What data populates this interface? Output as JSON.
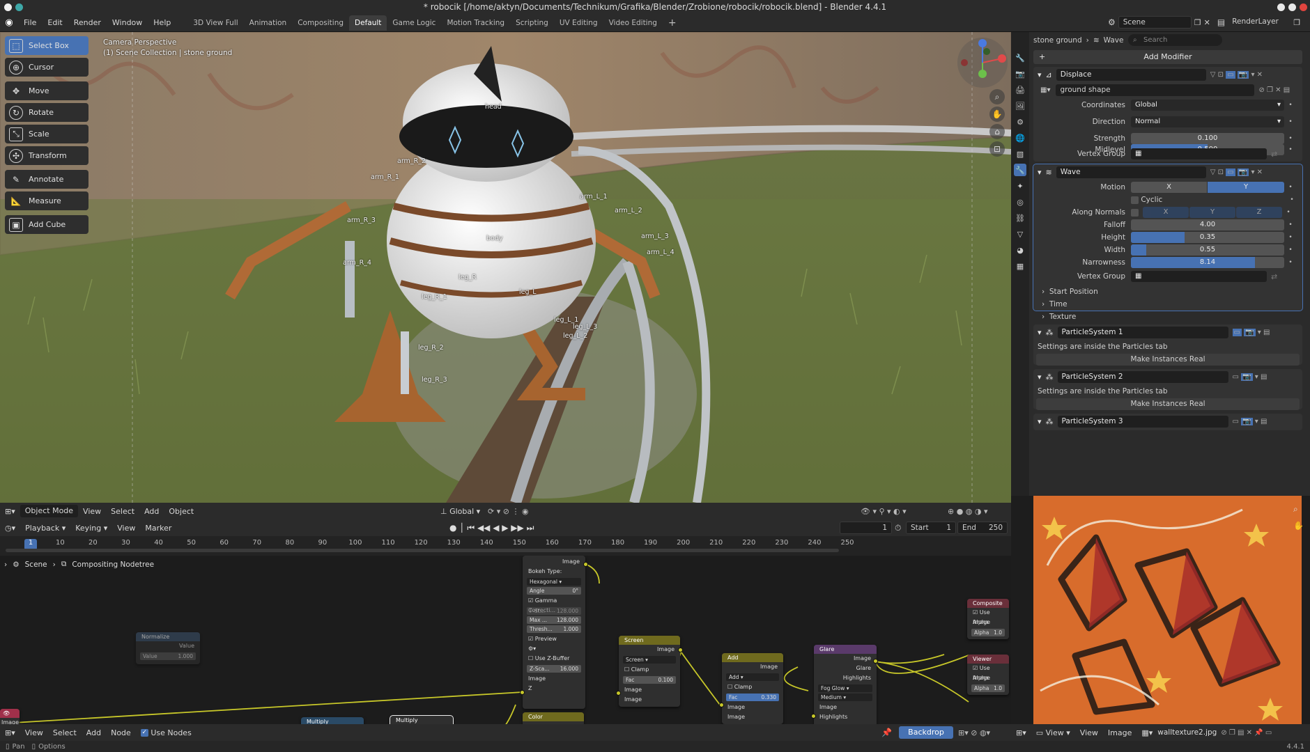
{
  "window": {
    "title": "* robocik [/home/aktyn/Documents/Technikum/Grafika/Blender/Zrobione/robocik/robocik.blend] - Blender 4.4.1"
  },
  "menu": [
    "File",
    "Edit",
    "Render",
    "Window",
    "Help"
  ],
  "workspaces": [
    "3D View Full",
    "Animation",
    "Compositing",
    "Default",
    "Game Logic",
    "Motion Tracking",
    "Scripting",
    "UV Editing",
    "Video Editing"
  ],
  "active_workspace": "Default",
  "scene": {
    "name": "Scene",
    "layer": "RenderLayer"
  },
  "viewport": {
    "perspective": "Camera Perspective",
    "collection": "(1) Scene Collection | stone ground",
    "tools": [
      "Select Box",
      "Cursor",
      "Move",
      "Rotate",
      "Scale",
      "Transform",
      "Annotate",
      "Measure",
      "Add Cube"
    ],
    "bones": [
      "head",
      "arm_R_2",
      "arm_R_1",
      "arm_R_3",
      "arm_R_4",
      "arm_L_1",
      "arm_L_2",
      "arm_L_3",
      "arm_L_4",
      "body",
      "leg_R",
      "leg_R_1",
      "leg_L",
      "leg_L_1",
      "leg_L_3",
      "leg_L_2",
      "leg_R_2",
      "leg_R_3"
    ],
    "header": {
      "mode": "Object Mode",
      "menus": [
        "View",
        "Select",
        "Add",
        "Object"
      ],
      "orientation": "Global"
    }
  },
  "timeline": {
    "menus": [
      "Playback",
      "Keying",
      "View",
      "Marker"
    ],
    "current_frame": "1",
    "start_label": "Start",
    "start": "1",
    "end_label": "End",
    "end": "250",
    "ticks": [
      "1",
      "10",
      "20",
      "30",
      "40",
      "50",
      "60",
      "70",
      "80",
      "90",
      "100",
      "110",
      "120",
      "130",
      "140",
      "150",
      "160",
      "170",
      "180",
      "190",
      "200",
      "210",
      "220",
      "230",
      "240",
      "250"
    ]
  },
  "node_editor": {
    "breadcrumb": [
      "Scene",
      "Compositing Nodetree"
    ],
    "menus": [
      "View",
      "Select",
      "Add",
      "Node"
    ],
    "use_nodes": "Use Nodes",
    "backdrop": "Backdrop",
    "nodes": {
      "normalize": {
        "title": "Normalize",
        "out": "Value",
        "in": "Value",
        "in_val": "1.000"
      },
      "bokeh": {
        "out": "Image",
        "type_label": "Bokeh Type:",
        "type": "Hexagonal",
        "angle_l": "Angle",
        "angle": "0°",
        "gamma": "Gamma Correcti...",
        "fstop_l": "F-St...",
        "fstop": "128.000",
        "max_l": "Max ...",
        "max": "128.000",
        "thresh_l": "Thresh...",
        "thresh": "1.000",
        "preview": "Preview",
        "zbuf": "Use Z-Buffer",
        "zscale_l": "Z-Sca...",
        "zscale": "16.000",
        "in_image": "Image",
        "in_z": "Z"
      },
      "screen": {
        "title": "Screen",
        "out": "Image",
        "mode": "Screen",
        "clamp": "Clamp",
        "fac_l": "Fac",
        "fac": "0.100",
        "in1": "Image",
        "in2": "Image"
      },
      "add": {
        "title": "Add",
        "out": "Image",
        "mode": "Add",
        "clamp": "Clamp",
        "fac_l": "Fac",
        "fac": "0.330",
        "in1": "Image",
        "in2": "Image"
      },
      "glare": {
        "title": "Glare",
        "out1": "Image",
        "out2": "Glare",
        "out3": "Highlights",
        "type": "Fog Glow",
        "quality": "Medium",
        "in": "Image",
        "hl": "Highlights"
      },
      "composite": {
        "title": "Composite",
        "alpha": "Use Alpha",
        "in1": "Image",
        "in2_l": "Alpha",
        "in2": "1.0"
      },
      "viewer": {
        "title": "Viewer",
        "alpha": "Use Alpha",
        "in1": "Image",
        "in2_l": "Alpha",
        "in2": "1.0"
      },
      "multiply1": "Multiply",
      "multiply2": "Multiply",
      "color": "Color",
      "img_in": "Image"
    }
  },
  "properties": {
    "breadcrumb": [
      "stone ground",
      "Wave"
    ],
    "search_placeholder": "Search",
    "add_modifier": "Add Modifier",
    "displace": {
      "name": "Displace",
      "texture": "ground shape",
      "coordinates_l": "Coordinates",
      "coordinates": "Global",
      "direction_l": "Direction",
      "direction": "Normal",
      "strength_l": "Strength",
      "strength": "0.100",
      "midlevel_l": "Midlevel",
      "midlevel": "0.500",
      "midlevel_frac": 0.5,
      "vgroup_l": "Vertex Group"
    },
    "wave": {
      "name": "Wave",
      "motion_l": "Motion",
      "motion_x": "X",
      "motion_y": "Y",
      "cyclic": "Cyclic",
      "normals_l": "Along Normals",
      "nx": "X",
      "ny": "Y",
      "nz": "Z",
      "falloff_l": "Falloff",
      "falloff": "4.00",
      "height_l": "Height",
      "height": "0.35",
      "height_frac": 0.35,
      "width_l": "Width",
      "width": "0.55",
      "width_frac": 0.1,
      "narrow_l": "Narrowness",
      "narrow": "8.14",
      "narrow_frac": 0.81,
      "vgroup_l": "Vertex Group",
      "subpanels": [
        "Start Position",
        "Time",
        "Texture"
      ]
    },
    "particles": [
      {
        "name": "ParticleSystem 1",
        "note": "Settings are inside the Particles tab",
        "button": "Make Instances Real"
      },
      {
        "name": "ParticleSystem 2",
        "note": "Settings are inside the Particles tab",
        "button": "Make Instances Real"
      },
      {
        "name": "ParticleSystem 3"
      }
    ]
  },
  "image_editor": {
    "menus": [
      "View",
      "View",
      "Image"
    ],
    "image": "walltexture2.jpg"
  },
  "statusbar": {
    "left1": "Pan",
    "left2": "Options",
    "version": "4.4.1"
  },
  "colors": {
    "accent": "#4772b3",
    "socket_yellow": "#c7c729",
    "bg": "#1d1d1d"
  }
}
